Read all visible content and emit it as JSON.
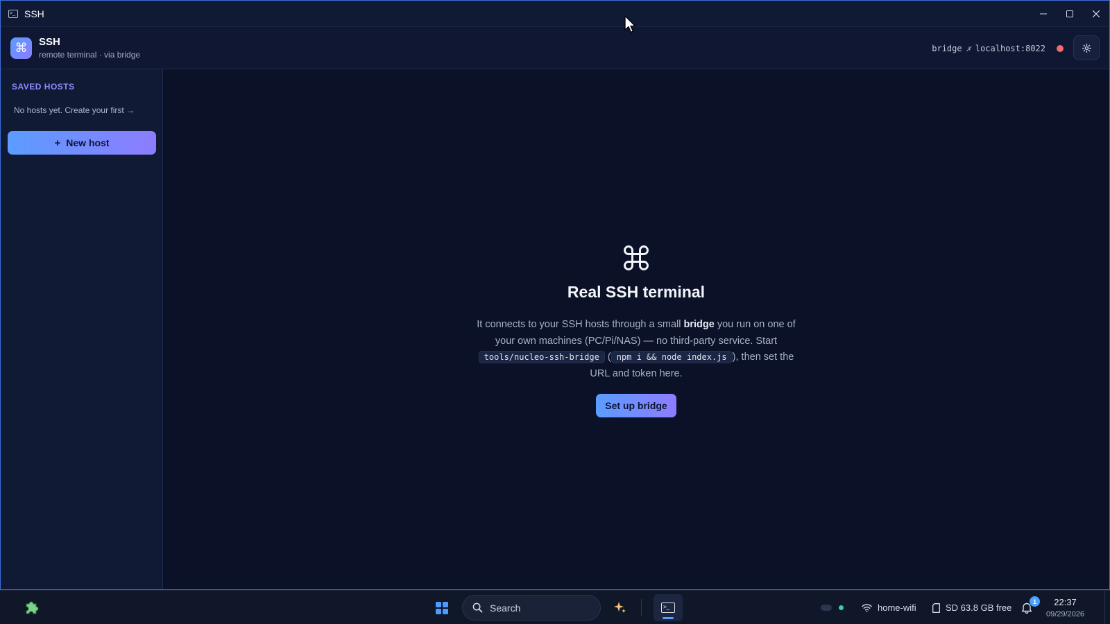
{
  "window": {
    "title": "SSH"
  },
  "header": {
    "app_name": "SSH",
    "subtitle": "remote terminal · via bridge",
    "bridge_label": "bridge",
    "bridge_state_glyph": "✗",
    "bridge_address": "localhost:8022",
    "status_color": "#f26b6b"
  },
  "sidebar": {
    "heading": "SAVED HOSTS",
    "empty_text": "No hosts yet. Create your first →",
    "new_host_plus": "+",
    "new_host_label": "New host"
  },
  "main": {
    "title": "Real SSH terminal",
    "desc_part1": "It connects to your SSH hosts through a small ",
    "desc_bold": "bridge",
    "desc_part2": " you run on one of your own machines (PC/Pi/NAS) — no third-party service. Start ",
    "code1": "tools/nucleo-ssh-bridge",
    "desc_part3": " (",
    "code2": "npm i && node index.js",
    "desc_part4": "), then set the URL and token here.",
    "setup_button": "Set up bridge"
  },
  "taskbar": {
    "search_label": "Search",
    "wifi_label": "home-wifi",
    "storage_label": "SD 63.8 GB free",
    "notification_count": "1",
    "time": "22:37",
    "date": "09/29/2026"
  },
  "colors": {
    "accent_start": "#5b9cff",
    "accent_end": "#8d7cff",
    "heading_purple": "#8e8dff",
    "background": "#0b1228"
  }
}
